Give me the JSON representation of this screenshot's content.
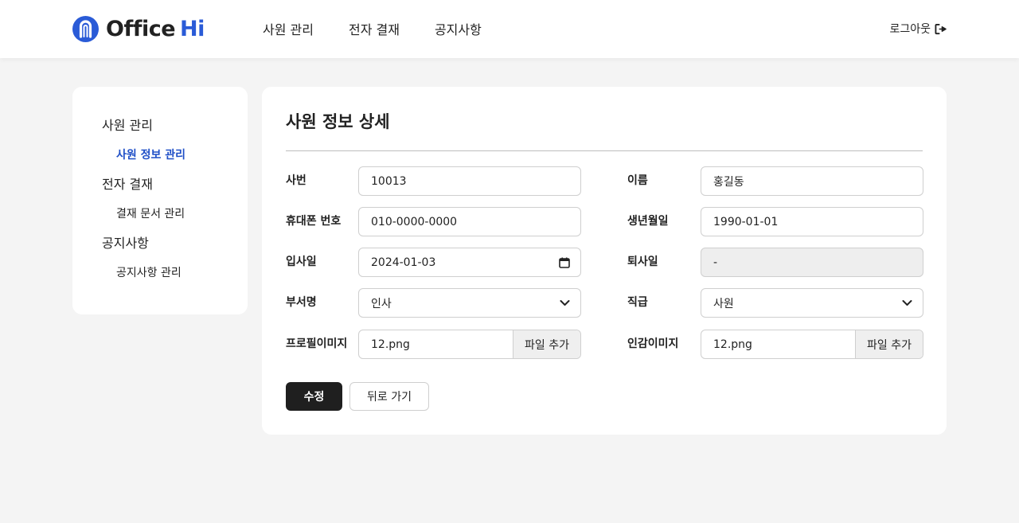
{
  "brand": {
    "name_part1": "Office",
    "name_part2": "Hi",
    "accent": "#2a5bd7"
  },
  "nav": {
    "items": [
      "사원 관리",
      "전자 결재",
      "공지사항"
    ],
    "logout": "로그아웃",
    "logout_icon": "logout-icon"
  },
  "sidebar": {
    "groups": [
      {
        "title": "사원 관리",
        "items": [
          "사원 정보 관리"
        ]
      },
      {
        "title": "전자 결재",
        "items": [
          "결재 문서 관리"
        ]
      },
      {
        "title": "공지사항",
        "items": [
          "공지사항 관리"
        ]
      }
    ],
    "active_color": "#1f4fc7"
  },
  "form": {
    "title": "사원 정보 상세",
    "emp_no": {
      "label": "사번",
      "value": "10013"
    },
    "name": {
      "label": "이름",
      "value": "홍길동"
    },
    "phone": {
      "label": "휴대폰 번호",
      "value": "010-0000-0000"
    },
    "birth": {
      "label": "생년월일",
      "value": "1990-01-01"
    },
    "hire_date": {
      "label": "입사일",
      "value": "2024-01-03"
    },
    "leave_date": {
      "label": "퇴사일",
      "value": "-"
    },
    "department": {
      "label": "부서명",
      "value": "인사"
    },
    "position": {
      "label": "직급",
      "value": "사원"
    },
    "profile_image": {
      "label": "프로필이미지",
      "value": "12.png",
      "button": "파일 추가"
    },
    "seal_image": {
      "label": "인감이미지",
      "value": "12.png",
      "button": "파일 추가"
    },
    "submit": "수정",
    "back": "뒤로 가기"
  }
}
